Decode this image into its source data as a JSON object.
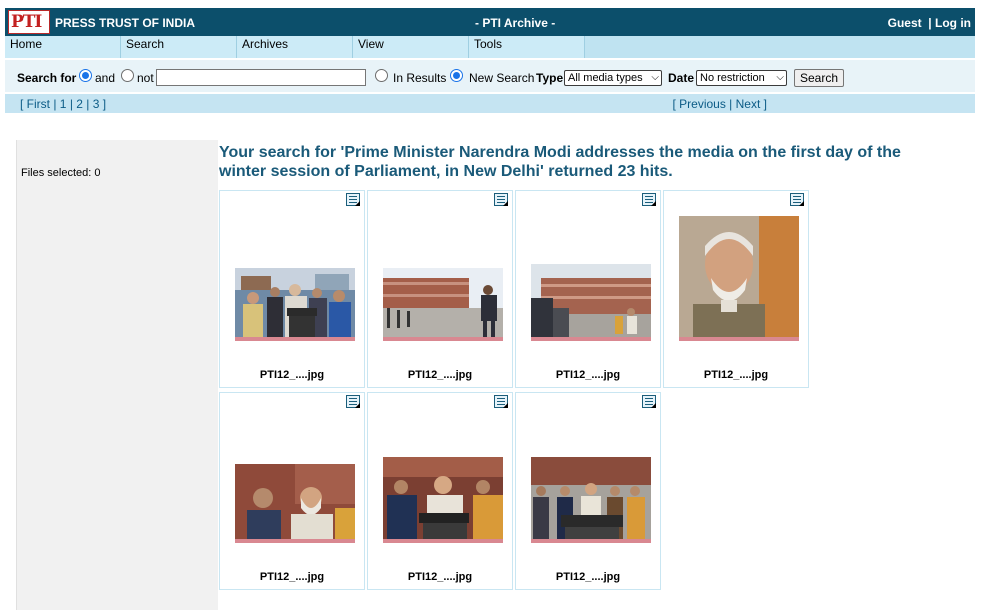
{
  "header": {
    "logo_text": "PTI",
    "brand": "PRESS TRUST OF INDIA",
    "app_title": "- PTI Archive -",
    "guest": "Guest",
    "separator": "|",
    "login": "Log in"
  },
  "menu": [
    "Home",
    "Search",
    "Archives",
    "View",
    "Tools"
  ],
  "search": {
    "label": "Search for",
    "and_label": "and",
    "not_label": "not",
    "query_value": "",
    "in_results_label": "In Results",
    "new_search_label": "New Search",
    "type_label": "Type",
    "type_value": "All media types",
    "date_label": "Date",
    "date_value": "No restriction",
    "button_label": "Search",
    "selected_mode": "and",
    "selected_scope": "New Search"
  },
  "pager": {
    "first": "First",
    "pages": [
      "1",
      "2",
      "3"
    ],
    "previous": "Previous",
    "next": "Next"
  },
  "sidebar": {
    "files_selected": "Files selected: 0"
  },
  "results": {
    "message": "Your search for 'Prime Minister Narendra Modi addresses the media on the first day of the winter session of Parliament, in New Delhi' returned 23 hits.",
    "items": [
      {
        "filename": "PTI12_....jpg",
        "scene": "group"
      },
      {
        "filename": "PTI12_....jpg",
        "scene": "parliament-guard"
      },
      {
        "filename": "PTI12_....jpg",
        "scene": "parliament-media"
      },
      {
        "filename": "PTI12_....jpg",
        "scene": "portrait"
      },
      {
        "filename": "PTI12_....jpg",
        "scene": "group-close"
      },
      {
        "filename": "PTI12_....jpg",
        "scene": "group-mics"
      },
      {
        "filename": "PTI12_....jpg",
        "scene": "group-wide"
      }
    ]
  },
  "colors": {
    "header_bg": "#0c4f6b",
    "menu_bg": "#ccebf7",
    "link": "#0b5b86",
    "title_text": "#1a5a79",
    "thumb_underline": "#d98891"
  }
}
